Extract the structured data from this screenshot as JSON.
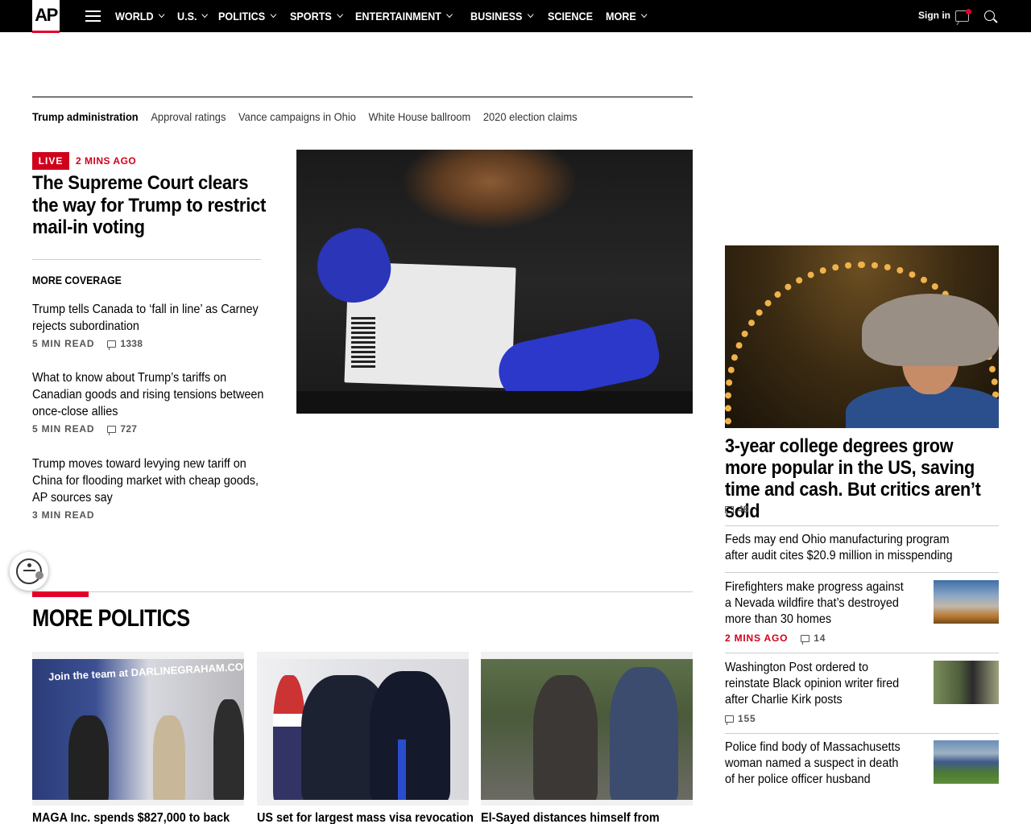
{
  "header": {
    "logo": "AP",
    "nav": [
      {
        "label": "WORLD",
        "dropdown": true
      },
      {
        "label": "U.S.",
        "dropdown": true
      },
      {
        "label": "POLITICS",
        "dropdown": true
      },
      {
        "label": "SPORTS",
        "dropdown": true
      },
      {
        "label": "ENTERTAINMENT",
        "dropdown": true
      },
      {
        "label": "BUSINESS",
        "dropdown": true
      },
      {
        "label": "SCIENCE",
        "dropdown": false
      },
      {
        "label": "MORE",
        "dropdown": true
      }
    ],
    "signin": "Sign in",
    "accent": "#e4002b"
  },
  "topics": [
    "Trump administration",
    "Approval ratings",
    "Vance campaigns in Ohio",
    "White House ballroom",
    "2020 election claims"
  ],
  "lead": {
    "badge": "LIVE",
    "time": "2 MINS AGO",
    "title": "The Supreme Court clears the way for Trump to restrict mail-in voting"
  },
  "more_coverage": {
    "heading": "MORE COVERAGE",
    "items": [
      {
        "title": "Trump tells Canada to ‘fall in line’ as Carney rejects subordination",
        "read": "5 MIN READ",
        "comments": "1338"
      },
      {
        "title": "What to know about Trump’s tariffs on Canadian goods and rising tensions between once-close allies",
        "read": "5 MIN READ",
        "comments": "727"
      },
      {
        "title": "Trump moves toward levying new tariff on China for flooding market with cheap goods, AP sources say",
        "read": "3 MIN READ",
        "comments": ""
      }
    ]
  },
  "more_politics": {
    "heading": "MORE POLITICS",
    "cards": [
      {
        "title": "MAGA Inc. spends $827,000 to back",
        "banner": "Join the team at DARLINEGRAHAM.COM"
      },
      {
        "title": "US set for largest mass visa revocation"
      },
      {
        "title": "El-Sayed distances himself from"
      }
    ]
  },
  "sidebar": {
    "feature": {
      "title": "3-year college degrees grow more popular in the US, saving time and cash. But critics aren’t sold",
      "comments": "48"
    },
    "items": [
      {
        "title": "Feds may end Ohio manufacturing program after audit cites $20.9 million in misspending"
      },
      {
        "title": "Firefighters make progress against a Nevada wildfire that’s destroyed more than 30 homes",
        "time": "2 MINS AGO",
        "comments": "14"
      },
      {
        "title": "Washington Post ordered to reinstate Black opinion writer fired after Charlie Kirk posts",
        "comments": "155"
      },
      {
        "title": "Police find body of Massachusetts woman named a suspect in death of her police officer husband"
      }
    ]
  }
}
